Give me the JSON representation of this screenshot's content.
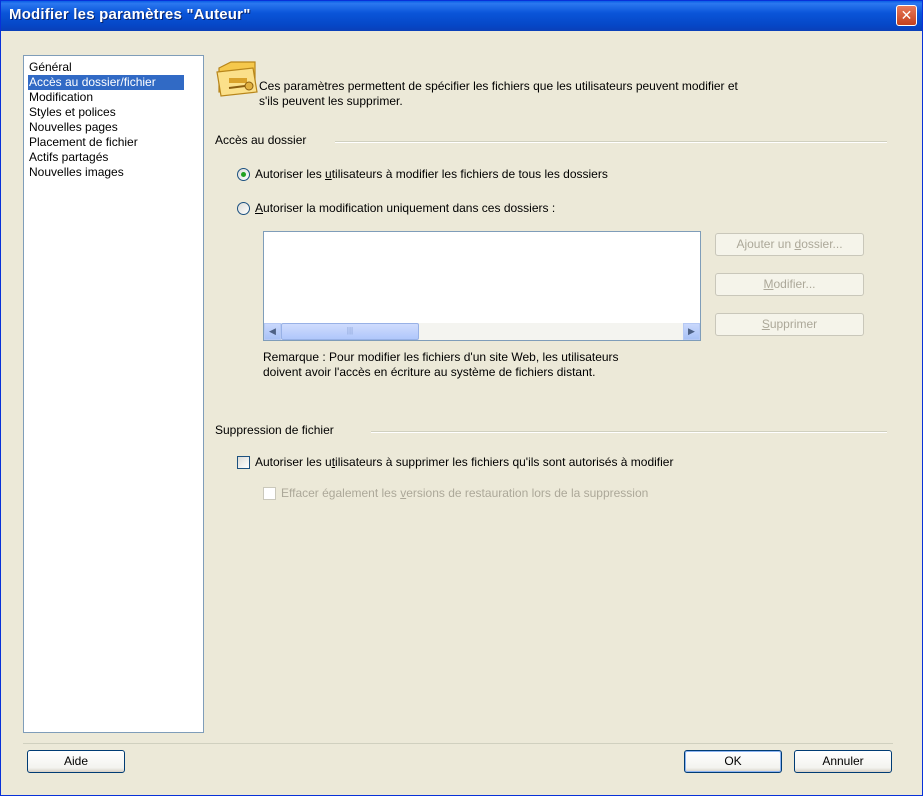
{
  "window": {
    "title": "Modifier les paramètres \"Auteur\"",
    "close_glyph": "✕"
  },
  "sidebar": {
    "items": [
      {
        "label": "Général",
        "selected": false
      },
      {
        "label": "Accès au dossier/fichier",
        "selected": true
      },
      {
        "label": "Modification",
        "selected": false
      },
      {
        "label": "Styles et polices",
        "selected": false
      },
      {
        "label": "Nouvelles pages",
        "selected": false
      },
      {
        "label": "Placement de fichier",
        "selected": false
      },
      {
        "label": "Actifs partagés",
        "selected": false
      },
      {
        "label": "Nouvelles images",
        "selected": false
      }
    ]
  },
  "intro": {
    "icon": "folder-key-icon",
    "text_line1": "Ces paramètres permettent de spécifier les fichiers que les utilisateurs peuvent modifier et",
    "text_line2": "s'ils peuvent les supprimer."
  },
  "folder_access": {
    "heading": "Accès au dossier",
    "radio_all": {
      "pre": "Autoriser les ",
      "mnemonic": "u",
      "post": "tilisateurs à modifier les fichiers de tous les dossiers",
      "checked": true
    },
    "radio_only": {
      "pre": "",
      "mnemonic": "A",
      "post": "utoriser la modification uniquement dans ces dossiers :",
      "checked": false
    },
    "buttons": {
      "add": {
        "pre": "Ajouter un ",
        "mnemonic": "d",
        "post": "ossier..."
      },
      "edit": {
        "pre": "",
        "mnemonic": "M",
        "post": "odifier..."
      },
      "delete": {
        "pre": "",
        "mnemonic": "S",
        "post": "upprimer"
      }
    },
    "scroll": {
      "left": "◀",
      "right": "▶",
      "grip": "|||"
    },
    "note_line1": "Remarque : Pour modifier les fichiers d'un site Web, les utilisateurs",
    "note_line2": "doivent avoir l'accès en écriture au système de fichiers distant."
  },
  "file_deletion": {
    "heading": "Suppression de fichier",
    "checkbox_allow": {
      "pre": "Autoriser les u",
      "mnemonic": "t",
      "post": "ilisateurs à supprimer les fichiers qu'ils sont autorisés à modifier",
      "checked": false
    },
    "checkbox_versions": {
      "pre": "Effacer également les ",
      "mnemonic": "v",
      "post": "ersions de restauration lors de la suppression",
      "checked": false,
      "disabled": true
    }
  },
  "footer": {
    "help": "Aide",
    "ok": "OK",
    "cancel": "Annuler"
  }
}
